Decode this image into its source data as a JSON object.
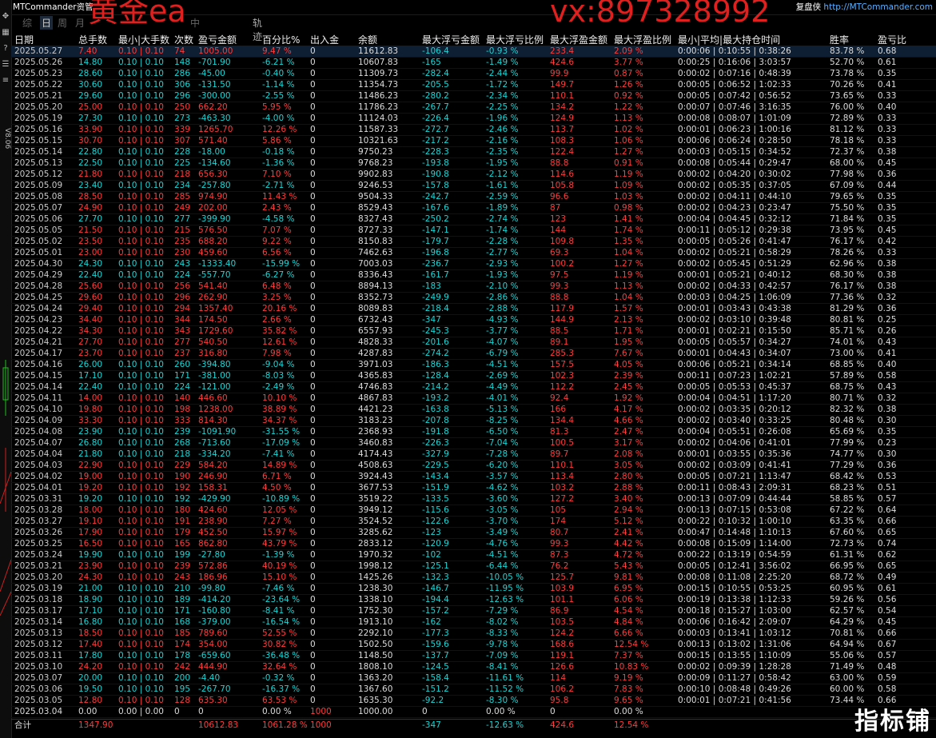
{
  "app": {
    "title": "MTCommander资管",
    "watermark_left": "黄金ea",
    "watermark_right": "vx:897328992",
    "review_label": "复盘侠",
    "review_url": "http://MTCommander.com",
    "version": "V8.06",
    "brand_bottom": "指标铺"
  },
  "tabs": [
    "综",
    "日",
    "周",
    "月",
    "",
    "",
    "",
    "中"
  ],
  "active_tab": 1,
  "tab_track": "轨迹",
  "toolbar_icons": [
    "move-icon",
    "chart-icon",
    "help-icon",
    "settings-icon",
    "list-icon"
  ],
  "columns": [
    "日期",
    "总手数",
    "最小|大手数",
    "次数",
    "盈亏金额",
    "百分比%",
    "出入金",
    "余额",
    "最大浮亏金额",
    "最大浮亏比例",
    "最大浮盈金额",
    "最大浮盈比例",
    "最小|平均|最大持仓时间",
    "胜率",
    "盈亏比"
  ],
  "rows": [
    [
      "2025.05.27",
      "7.40",
      "0.10 | 0.10",
      "74",
      "1005.00",
      "9.47 %",
      "0",
      "11612.83",
      "-106.4",
      "-0.93 %",
      "233.4",
      "2.09 %",
      "0:00:06 | 0:10:55 | 0:38:26",
      "83.78 %",
      "0.68"
    ],
    [
      "2025.05.26",
      "14.80",
      "0.10 | 0.10",
      "148",
      "-701.90",
      "-6.21 %",
      "0",
      "10607.83",
      "-165",
      "-1.49 %",
      "424.6",
      "3.77 %",
      "0:00:25 | 0:16:06 | 3:03:57",
      "52.70 %",
      "0.61"
    ],
    [
      "2025.05.23",
      "28.60",
      "0.10 | 0.10",
      "286",
      "-45.00",
      "-0.40 %",
      "0",
      "11309.73",
      "-282.4",
      "-2.44 %",
      "99.9",
      "0.87 %",
      "0:00:02 | 0:07:16 | 0:48:39",
      "73.78 %",
      "0.35"
    ],
    [
      "2025.05.22",
      "30.60",
      "0.10 | 0.10",
      "306",
      "-131.50",
      "-1.14 %",
      "0",
      "11354.73",
      "-205.5",
      "-1.72 %",
      "149.7",
      "1.26 %",
      "0:00:05 | 0:06:52 | 1:02:33",
      "70.26 %",
      "0.41"
    ],
    [
      "2025.05.21",
      "29.60",
      "0.10 | 0.10",
      "296",
      "-300.00",
      "-2.55 %",
      "0",
      "11486.23",
      "-280.2",
      "-2.34 %",
      "110.1",
      "0.92 %",
      "0:00:05 | 0:07:42 | 0:56:52",
      "73.65 %",
      "0.33"
    ],
    [
      "2025.05.20",
      "25.00",
      "0.10 | 0.10",
      "250",
      "662.20",
      "5.95 %",
      "0",
      "11786.23",
      "-267.7",
      "-2.25 %",
      "134.2",
      "1.22 %",
      "0:00:07 | 0:07:46 | 3:16:35",
      "76.00 %",
      "0.40"
    ],
    [
      "2025.05.19",
      "27.30",
      "0.10 | 0.10",
      "273",
      "-463.30",
      "-4.00 %",
      "0",
      "11124.03",
      "-226.4",
      "-1.96 %",
      "124.9",
      "1.13 %",
      "0:00:08 | 0:08:07 | 1:01:09",
      "72.89 %",
      "0.33"
    ],
    [
      "2025.05.16",
      "33.90",
      "0.10 | 0.10",
      "339",
      "1265.70",
      "12.26 %",
      "0",
      "11587.33",
      "-272.7",
      "-2.46 %",
      "113.7",
      "1.02 %",
      "0:00:01 | 0:06:23 | 1:00:16",
      "81.12 %",
      "0.33"
    ],
    [
      "2025.05.15",
      "30.70",
      "0.10 | 0.10",
      "307",
      "571.40",
      "5.86 %",
      "0",
      "10321.63",
      "-217.2",
      "-2.16 %",
      "108.3",
      "1.06 %",
      "0:00:06 | 0:06:24 | 0:28:50",
      "78.18 %",
      "0.33"
    ],
    [
      "2025.05.14",
      "22.80",
      "0.10 | 0.10",
      "228",
      "-18.00",
      "-0.18 %",
      "0",
      "9750.23",
      "-228.3",
      "-2.35 %",
      "122.4",
      "1.27 %",
      "0:00:03 | 0:05:15 | 0:34:52",
      "72.37 %",
      "0.38"
    ],
    [
      "2025.05.13",
      "22.50",
      "0.10 | 0.10",
      "225",
      "-134.60",
      "-1.36 %",
      "0",
      "9768.23",
      "-193.8",
      "-1.95 %",
      "88.8",
      "0.91 %",
      "0:00:08 | 0:05:44 | 0:29:47",
      "68.00 %",
      "0.45"
    ],
    [
      "2025.05.12",
      "21.80",
      "0.10 | 0.10",
      "218",
      "656.30",
      "7.10 %",
      "0",
      "9902.83",
      "-190.8",
      "-2.12 %",
      "114.6",
      "1.19 %",
      "0:00:02 | 0:04:20 | 0:30:02",
      "77.98 %",
      "0.36"
    ],
    [
      "2025.05.09",
      "23.40",
      "0.10 | 0.10",
      "234",
      "-257.80",
      "-2.71 %",
      "0",
      "9246.53",
      "-157.8",
      "-1.61 %",
      "105.8",
      "1.09 %",
      "0:00:02 | 0:05:35 | 0:37:05",
      "67.09 %",
      "0.44"
    ],
    [
      "2025.05.08",
      "28.50",
      "0.10 | 0.10",
      "285",
      "974.90",
      "11.43 %",
      "0",
      "9504.33",
      "-242.7",
      "-2.59 %",
      "96.6",
      "1.03 %",
      "0:00:02 | 0:04:11 | 0:44:10",
      "79.65 %",
      "0.35"
    ],
    [
      "2025.05.07",
      "24.90",
      "0.10 | 0.10",
      "249",
      "202.00",
      "2.43 %",
      "0",
      "8529.43",
      "-167.6",
      "-1.89 %",
      "87",
      "0.98 %",
      "0:00:02 | 0:04:23 | 0:23:47",
      "75.50 %",
      "0.35"
    ],
    [
      "2025.05.06",
      "27.70",
      "0.10 | 0.10",
      "277",
      "-399.90",
      "-4.58 %",
      "0",
      "8327.43",
      "-250.2",
      "-2.74 %",
      "123",
      "1.41 %",
      "0:00:04 | 0:04:45 | 0:32:12",
      "71.84 %",
      "0.35"
    ],
    [
      "2025.05.05",
      "21.50",
      "0.10 | 0.10",
      "215",
      "576.50",
      "7.07 %",
      "0",
      "8727.33",
      "-147.1",
      "-1.74 %",
      "144",
      "1.74 %",
      "0:00:11 | 0:05:12 | 0:29:38",
      "73.95 %",
      "0.45"
    ],
    [
      "2025.05.02",
      "23.50",
      "0.10 | 0.10",
      "235",
      "688.20",
      "9.22 %",
      "0",
      "8150.83",
      "-179.7",
      "-2.28 %",
      "109.8",
      "1.35 %",
      "0:00:05 | 0:05:26 | 0:41:47",
      "76.17 %",
      "0.42"
    ],
    [
      "2025.05.01",
      "23.00",
      "0.10 | 0.10",
      "230",
      "459.60",
      "6.56 %",
      "0",
      "7462.63",
      "-196.8",
      "-2.77 %",
      "69.3",
      "1.04 %",
      "0:00:02 | 0:05:21 | 0:58:29",
      "78.26 %",
      "0.33"
    ],
    [
      "2025.04.30",
      "24.30",
      "0.10 | 0.10",
      "243",
      "-1333.40",
      "-15.99 %",
      "0",
      "7003.03",
      "-236.7",
      "-2.93 %",
      "100.2",
      "1.27 %",
      "0:00:02 | 0:05:45 | 0:51:29",
      "62.96 %",
      "0.38"
    ],
    [
      "2025.04.29",
      "22.40",
      "0.10 | 0.10",
      "224",
      "-557.70",
      "-6.27 %",
      "0",
      "8336.43",
      "-161.7",
      "-1.93 %",
      "97.5",
      "1.19 %",
      "0:00:01 | 0:05:21 | 0:40:12",
      "68.30 %",
      "0.38"
    ],
    [
      "2025.04.28",
      "25.60",
      "0.10 | 0.10",
      "256",
      "541.40",
      "6.48 %",
      "0",
      "8894.13",
      "-183",
      "-2.10 %",
      "99.3",
      "1.13 %",
      "0:00:02 | 0:04:33 | 0:42:57",
      "76.17 %",
      "0.38"
    ],
    [
      "2025.04.25",
      "29.60",
      "0.10 | 0.10",
      "296",
      "262.90",
      "3.25 %",
      "0",
      "8352.73",
      "-249.9",
      "-2.86 %",
      "88.8",
      "1.04 %",
      "0:00:03 | 0:04:25 | 1:06:09",
      "77.36 %",
      "0.32"
    ],
    [
      "2025.04.24",
      "29.40",
      "0.10 | 0.10",
      "294",
      "1357.40",
      "20.16 %",
      "0",
      "8089.83",
      "-218.4",
      "-2.88 %",
      "117.9",
      "1.57 %",
      "0:00:01 | 0:03:43 | 0:43:38",
      "81.29 %",
      "0.36"
    ],
    [
      "2025.04.23",
      "34.40",
      "0.10 | 0.10",
      "344",
      "174.50",
      "2.66 %",
      "0",
      "6732.43",
      "-347",
      "-4.93 %",
      "144.9",
      "2.13 %",
      "0:00:02 | 0:03:10 | 0:39:48",
      "80.81 %",
      "0.25"
    ],
    [
      "2025.04.22",
      "34.30",
      "0.10 | 0.10",
      "343",
      "1729.60",
      "35.82 %",
      "0",
      "6557.93",
      "-245.3",
      "-3.77 %",
      "88.5",
      "1.71 %",
      "0:00:01 | 0:02:21 | 0:15:50",
      "85.71 %",
      "0.26"
    ],
    [
      "2025.04.21",
      "27.70",
      "0.10 | 0.10",
      "277",
      "540.50",
      "12.61 %",
      "0",
      "4828.33",
      "-201.6",
      "-4.07 %",
      "89.1",
      "1.95 %",
      "0:00:05 | 0:05:57 | 0:34:27",
      "74.01 %",
      "0.43"
    ],
    [
      "2025.04.17",
      "23.70",
      "0.10 | 0.10",
      "237",
      "316.80",
      "7.98 %",
      "0",
      "4287.83",
      "-274.2",
      "-6.79 %",
      "285.3",
      "7.67 %",
      "0:00:01 | 0:04:43 | 0:34:07",
      "73.00 %",
      "0.41"
    ],
    [
      "2025.04.16",
      "26.00",
      "0.10 | 0.10",
      "260",
      "-394.80",
      "-9.04 %",
      "0",
      "3971.03",
      "-186.3",
      "-4.51 %",
      "157.5",
      "4.05 %",
      "0:00:06 | 0:05:21 | 0:34:14",
      "68.85 %",
      "0.40"
    ],
    [
      "2025.04.15",
      "17.10",
      "0.10 | 0.10",
      "171",
      "-381.00",
      "-8.03 %",
      "0",
      "4365.83",
      "-128.4",
      "-2.69 %",
      "102.3",
      "2.39 %",
      "0:00:11 | 0:07:23 | 1:02:21",
      "57.89 %",
      "0.58"
    ],
    [
      "2025.04.14",
      "22.40",
      "0.10 | 0.10",
      "224",
      "-121.00",
      "-2.49 %",
      "0",
      "4746.83",
      "-214.2",
      "-4.49 %",
      "112.2",
      "2.45 %",
      "0:00:05 | 0:05:53 | 0:45:37",
      "68.75 %",
      "0.43"
    ],
    [
      "2025.04.11",
      "14.00",
      "0.10 | 0.10",
      "140",
      "446.60",
      "10.10 %",
      "0",
      "4867.83",
      "-193.2",
      "-4.01 %",
      "92.4",
      "1.92 %",
      "0:00:04 | 0:04:51 | 1:17:20",
      "80.71 %",
      "0.32"
    ],
    [
      "2025.04.10",
      "19.80",
      "0.10 | 0.10",
      "198",
      "1238.00",
      "38.89 %",
      "0",
      "4421.23",
      "-163.8",
      "-5.13 %",
      "166",
      "4.17 %",
      "0:00:02 | 0:03:35 | 0:20:12",
      "82.32 %",
      "0.38"
    ],
    [
      "2025.04.09",
      "33.30",
      "0.10 | 0.10",
      "333",
      "814.30",
      "34.37 %",
      "0",
      "3183.23",
      "-207.8",
      "-8.25 %",
      "134.4",
      "4.66 %",
      "0:00:02 | 0:03:40 | 0:33:25",
      "80.48 %",
      "0.30"
    ],
    [
      "2025.04.08",
      "23.90",
      "0.10 | 0.10",
      "239",
      "-1091.90",
      "-31.55 %",
      "0",
      "2368.93",
      "-191.8",
      "-6.50 %",
      "81.3",
      "2.47 %",
      "0:00:04 | 0:05:51 | 0:26:08",
      "65.69 %",
      "0.35"
    ],
    [
      "2025.04.07",
      "26.80",
      "0.10 | 0.10",
      "268",
      "-713.60",
      "-17.09 %",
      "0",
      "3460.83",
      "-226.3",
      "-7.04 %",
      "100.5",
      "3.17 %",
      "0:00:02 | 0:04:06 | 0:41:01",
      "77.99 %",
      "0.23"
    ],
    [
      "2025.04.04",
      "21.80",
      "0.10 | 0.10",
      "218",
      "-334.20",
      "-7.41 %",
      "0",
      "4174.43",
      "-327.9",
      "-7.28 %",
      "89.7",
      "2.08 %",
      "0:00:01 | 0:03:55 | 0:35:36",
      "74.77 %",
      "0.30"
    ],
    [
      "2025.04.03",
      "22.90",
      "0.10 | 0.10",
      "229",
      "584.20",
      "14.89 %",
      "0",
      "4508.63",
      "-229.5",
      "-6.20 %",
      "110.1",
      "3.05 %",
      "0:00:02 | 0:03:09 | 0:41:41",
      "77.29 %",
      "0.36"
    ],
    [
      "2025.04.02",
      "19.00",
      "0.10 | 0.10",
      "190",
      "246.90",
      "6.71 %",
      "0",
      "3924.43",
      "-143.4",
      "-3.57 %",
      "113.4",
      "2.80 %",
      "0:00:05 | 0:07:21 | 1:13:47",
      "68.42 %",
      "0.53"
    ],
    [
      "2025.04.01",
      "19.20",
      "0.10 | 0.10",
      "192",
      "158.31",
      "4.50 %",
      "0",
      "3677.53",
      "-151.9",
      "-4.62 %",
      "103.2",
      "2.88 %",
      "0:00:11 | 0:08:43 | 2:09:31",
      "68.23 %",
      "0.51"
    ],
    [
      "2025.03.31",
      "19.20",
      "0.10 | 0.10",
      "192",
      "-429.90",
      "-10.89 %",
      "0",
      "3519.22",
      "-133.5",
      "-3.60 %",
      "127.2",
      "3.40 %",
      "0:00:13 | 0:07:09 | 0:44:44",
      "58.85 %",
      "0.57"
    ],
    [
      "2025.03.28",
      "18.00",
      "0.10 | 0.10",
      "180",
      "424.60",
      "12.05 %",
      "0",
      "3949.12",
      "-115.6",
      "-3.05 %",
      "105",
      "2.94 %",
      "0:00:13 | 0:07:15 | 0:53:08",
      "67.22 %",
      "0.64"
    ],
    [
      "2025.03.27",
      "19.10",
      "0.10 | 0.10",
      "191",
      "238.90",
      "7.27 %",
      "0",
      "3524.52",
      "-122.6",
      "-3.70 %",
      "174",
      "5.12 %",
      "0:00:22 | 0:10:32 | 1:00:10",
      "63.35 %",
      "0.66"
    ],
    [
      "2025.03.26",
      "17.90",
      "0.10 | 0.10",
      "179",
      "452.50",
      "15.97 %",
      "0",
      "3285.62",
      "-123",
      "-3.49 %",
      "80.7",
      "2.41 %",
      "0:00:47 | 0:14:48 | 1:10:13",
      "67.60 %",
      "0.65"
    ],
    [
      "2025.03.25",
      "16.50",
      "0.10 | 0.10",
      "165",
      "862.80",
      "43.79 %",
      "0",
      "2833.12",
      "-120.9",
      "-4.76 %",
      "99.3",
      "4.42 %",
      "0:00:08 | 0:15:09 | 1:14:00",
      "72.73 %",
      "0.74"
    ],
    [
      "2025.03.24",
      "19.90",
      "0.10 | 0.10",
      "199",
      "-27.80",
      "-1.39 %",
      "0",
      "1970.32",
      "-102",
      "-4.51 %",
      "87.3",
      "4.72 %",
      "0:00:22 | 0:13:19 | 0:54:59",
      "61.31 %",
      "0.62"
    ],
    [
      "2025.03.21",
      "23.90",
      "0.10 | 0.10",
      "239",
      "572.86",
      "40.19 %",
      "0",
      "1998.12",
      "-125.1",
      "-6.44 %",
      "76.2",
      "5.43 %",
      "0:00:05 | 0:12:41 | 3:56:02",
      "66.95 %",
      "0.65"
    ],
    [
      "2025.03.20",
      "24.30",
      "0.10 | 0.10",
      "243",
      "186.96",
      "15.10 %",
      "0",
      "1425.26",
      "-132.3",
      "-10.05 %",
      "125.7",
      "9.81 %",
      "0:00:08 | 0:11:08 | 2:25:20",
      "68.72 %",
      "0.49"
    ],
    [
      "2025.03.19",
      "21.00",
      "0.10 | 0.10",
      "210",
      "-99.80",
      "-7.46 %",
      "0",
      "1238.30",
      "-146.7",
      "-11.95 %",
      "103.9",
      "6.95 %",
      "0:00:15 | 0:10:55 | 0:53:25",
      "60.95 %",
      "0.61"
    ],
    [
      "2025.03.18",
      "18.90",
      "0.10 | 0.10",
      "189",
      "-414.20",
      "-23.64 %",
      "0",
      "1338.10",
      "-194.4",
      "-12.63 %",
      "101.1",
      "6.06 %",
      "0:00:19 | 0:13:38 | 1:12:33",
      "59.26 %",
      "0.56"
    ],
    [
      "2025.03.17",
      "17.10",
      "0.10 | 0.10",
      "171",
      "-160.80",
      "-8.41 %",
      "0",
      "1752.30",
      "-157.2",
      "-7.29 %",
      "86.9",
      "4.54 %",
      "0:00:18 | 0:15:27 | 1:03:00",
      "62.57 %",
      "0.54"
    ],
    [
      "2025.03.14",
      "16.80",
      "0.10 | 0.10",
      "168",
      "-379.00",
      "-16.54 %",
      "0",
      "1913.10",
      "-162",
      "-8.02 %",
      "103.5",
      "4.84 %",
      "0:00:06 | 0:16:42 | 2:09:07",
      "64.29 %",
      "0.45"
    ],
    [
      "2025.03.13",
      "18.50",
      "0.10 | 0.10",
      "185",
      "789.60",
      "52.55 %",
      "0",
      "2292.10",
      "-177.3",
      "-8.33 %",
      "124.2",
      "6.66 %",
      "0:00:03 | 0:13:41 | 1:03:12",
      "70.81 %",
      "0.66"
    ],
    [
      "2025.03.12",
      "17.40",
      "0.10 | 0.10",
      "174",
      "354.00",
      "30.82 %",
      "0",
      "1502.50",
      "-159.6",
      "-9.78 %",
      "168.6",
      "12.54 %",
      "0:00:13 | 0:13:02 | 1:31:06",
      "64.94 %",
      "0.67"
    ],
    [
      "2025.03.11",
      "17.80",
      "0.10 | 0.10",
      "178",
      "-659.60",
      "-36.48 %",
      "0",
      "1148.50",
      "-137.7",
      "-7.09 %",
      "119.1",
      "7.37 %",
      "0:00:15 | 0:13:55 | 1:10:09",
      "55.06 %",
      "0.57"
    ],
    [
      "2025.03.10",
      "24.20",
      "0.10 | 0.10",
      "242",
      "444.90",
      "32.64 %",
      "0",
      "1808.10",
      "-124.5",
      "-8.41 %",
      "126.6",
      "10.83 %",
      "0:00:02 | 0:09:39 | 1:28:28",
      "71.49 %",
      "0.48"
    ],
    [
      "2025.03.07",
      "20.00",
      "0.10 | 0.10",
      "200",
      "-4.40",
      "-0.32 %",
      "0",
      "1363.20",
      "-158.4",
      "-11.61 %",
      "114",
      "9.19 %",
      "0:00:09 | 0:11:27 | 0:58:42",
      "63.00 %",
      "0.59"
    ],
    [
      "2025.03.06",
      "19.50",
      "0.10 | 0.10",
      "195",
      "-267.70",
      "-16.37 %",
      "0",
      "1367.60",
      "-151.2",
      "-11.52 %",
      "106.2",
      "7.83 %",
      "0:00:10 | 0:08:48 | 0:49:26",
      "60.00 %",
      "0.58"
    ],
    [
      "2025.03.05",
      "12.80",
      "0.10 | 0.10",
      "128",
      "635.30",
      "63.53 %",
      "0",
      "1635.30",
      "-92.2",
      "-8.30 %",
      "95.8",
      "9.65 %",
      "0:00:01 | 0:07:21 | 0:41:56",
      "73.44 %",
      "0.66"
    ],
    [
      "2025.03.04",
      "0.00",
      "0.00 | 0.00",
      "0",
      "0",
      "0.00 %",
      "1000",
      "1000.00",
      "0",
      "0.00 %",
      "0",
      "0.00 %",
      "",
      "",
      ""
    ]
  ],
  "total": {
    "label": "合计",
    "lots": "1347.90",
    "pnl": "10612.83",
    "pct": "1061.28 %",
    "inout": "1000",
    "max_float_loss": "-347",
    "max_float_loss_pct": "-12.63 %",
    "max_float_profit": "424.6",
    "max_float_profit_pct": "12.54 %"
  },
  "colors": {
    "positive": "#ff3c3c",
    "negative": "#19d6d6",
    "watermark": "#e0201e",
    "background": "#000000"
  }
}
